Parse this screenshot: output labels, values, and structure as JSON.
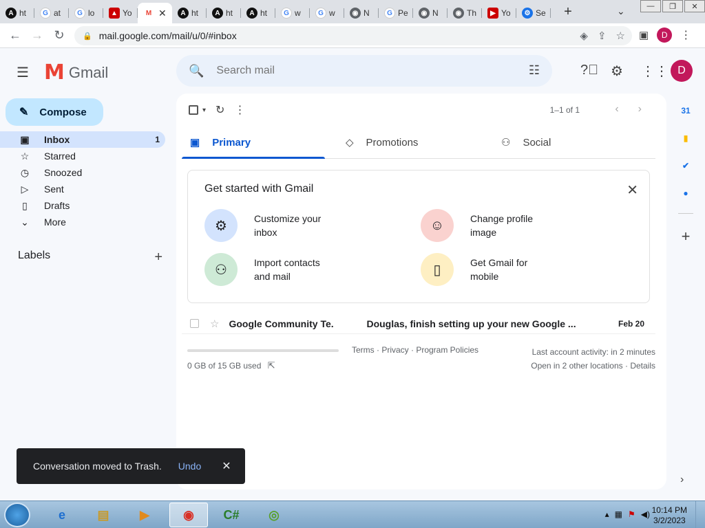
{
  "browser": {
    "tabs": [
      {
        "icon": "A",
        "label": "ht",
        "favclass": "dark"
      },
      {
        "icon": "G",
        "label": "at",
        "favclass": "g"
      },
      {
        "icon": "G",
        "label": "lo",
        "favclass": "g"
      },
      {
        "icon": "▲",
        "label": "Yo",
        "favclass": "red"
      },
      {
        "icon": "M",
        "label": "",
        "favclass": "gmail",
        "active": true
      },
      {
        "icon": "A",
        "label": "ht",
        "favclass": "dark"
      },
      {
        "icon": "A",
        "label": "ht",
        "favclass": "dark"
      },
      {
        "icon": "A",
        "label": "ht",
        "favclass": "dark"
      },
      {
        "icon": "G",
        "label": "w",
        "favclass": "g"
      },
      {
        "icon": "G",
        "label": "w",
        "favclass": "g"
      },
      {
        "icon": "◉",
        "label": "N",
        "favclass": "chrome"
      },
      {
        "icon": "G",
        "label": "Pe",
        "favclass": "g"
      },
      {
        "icon": "◉",
        "label": "N",
        "favclass": "chrome"
      },
      {
        "icon": "◉",
        "label": "Th",
        "favclass": "chrome"
      },
      {
        "icon": "▶",
        "label": "Yo",
        "favclass": "red"
      },
      {
        "icon": "⚙",
        "label": "Se",
        "favclass": "blue"
      }
    ],
    "url": "mail.google.com/mail/u/0/#inbox",
    "profile_initial": "D"
  },
  "gmail": {
    "brand": "Gmail",
    "search_placeholder": "Search mail",
    "avatar_initial": "D",
    "compose_label": "Compose",
    "nav": [
      {
        "label": "Inbox",
        "icon": "▣",
        "count": "1",
        "active": true
      },
      {
        "label": "Starred",
        "icon": "☆",
        "count": ""
      },
      {
        "label": "Snoozed",
        "icon": "◷",
        "count": ""
      },
      {
        "label": "Sent",
        "icon": "▷",
        "count": ""
      },
      {
        "label": "Drafts",
        "icon": "▯",
        "count": ""
      },
      {
        "label": "More",
        "icon": "⌄",
        "count": ""
      }
    ],
    "labels_heading": "Labels",
    "pager": "1–1 of 1",
    "tabs": [
      {
        "label": "Primary",
        "icon": "▣"
      },
      {
        "label": "Promotions",
        "icon": "◇"
      },
      {
        "label": "Social",
        "icon": "⚇"
      }
    ],
    "get_started": {
      "title": "Get started with Gmail",
      "items": [
        {
          "label": "Customize your inbox",
          "icon": "⚙",
          "color": "#d3e3fd"
        },
        {
          "label": "Change profile image",
          "icon": "☺",
          "color": "#fad2cf"
        },
        {
          "label": "Import contacts and mail",
          "icon": "⚇",
          "color": "#ceead6"
        },
        {
          "label": "Get Gmail for mobile",
          "icon": "▯",
          "color": "#feefc3"
        }
      ]
    },
    "emails": [
      {
        "sender": "Google Community Te.",
        "subject": "Douglas, finish setting up your new Google ...",
        "date": "Feb 20"
      }
    ],
    "footer": {
      "storage": "0 GB of 15 GB used",
      "storage_fraction": 0,
      "links": "Terms · Privacy · Program Policies",
      "activity": "Last account activity: in 2 minutes",
      "locations": "Open in 2 other locations · Details"
    },
    "snackbar": {
      "message": "Conversation moved to Trash.",
      "action": "Undo"
    }
  },
  "sidepanel": [
    {
      "name": "calendar-icon",
      "glyph": "31",
      "color": "#1a73e8"
    },
    {
      "name": "keep-icon",
      "glyph": "▮",
      "color": "#fbbc04"
    },
    {
      "name": "tasks-icon",
      "glyph": "✔",
      "color": "#1a73e8"
    },
    {
      "name": "contacts-icon",
      "glyph": "●",
      "color": "#1a73e8"
    }
  ],
  "taskbar": {
    "time": "10:14 PM",
    "date": "3/2/2023"
  }
}
